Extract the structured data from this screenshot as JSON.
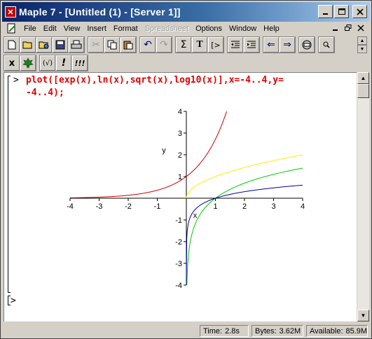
{
  "window": {
    "title": "Maple 7  - [Untitled (1) - [Server 1]]"
  },
  "menu": {
    "items": [
      {
        "label": "File",
        "enabled": true
      },
      {
        "label": "Edit",
        "enabled": true
      },
      {
        "label": "View",
        "enabled": true
      },
      {
        "label": "Insert",
        "enabled": true
      },
      {
        "label": "Format",
        "enabled": true
      },
      {
        "label": "Spreadsheet",
        "enabled": false
      },
      {
        "label": "Options",
        "enabled": true
      },
      {
        "label": "Window",
        "enabled": true
      },
      {
        "label": "Help",
        "enabled": true
      }
    ]
  },
  "toolbar": {
    "sigma_label": "Σ",
    "text_label": "T",
    "exec_label": "[>",
    "x_label": "x",
    "fn_label": "(√)",
    "bang_label": "!",
    "bangs_label": "!!!"
  },
  "worksheet": {
    "prompt1": ">",
    "command_line1": "plot([exp(x),ln(x),sqrt(x),log10(x)],x=-4..4,y=",
    "command_line2": "-4..4);",
    "prompt2": ">"
  },
  "chart_data": {
    "type": "line",
    "xlabel": "x",
    "ylabel": "y",
    "xlim": [
      -4,
      4
    ],
    "ylim": [
      -4,
      4
    ],
    "xticks": [
      -4,
      -3,
      -2,
      -1,
      1,
      2,
      3,
      4
    ],
    "yticks": [
      -4,
      -3,
      -2,
      -1,
      1,
      2,
      3,
      4
    ],
    "series": [
      {
        "function": "exp(x)",
        "color": "#cc0000"
      },
      {
        "function": "ln(x)",
        "color": "#00cc00"
      },
      {
        "function": "sqrt(x)",
        "color": "#ffee00"
      },
      {
        "function": "log10(x)",
        "color": "#0000aa"
      }
    ]
  },
  "status": {
    "time_label": "Time:",
    "time_value": "2.8s",
    "bytes_label": "Bytes:",
    "bytes_value": "3.62M",
    "avail_label": "Available:",
    "avail_value": "85.9M"
  }
}
